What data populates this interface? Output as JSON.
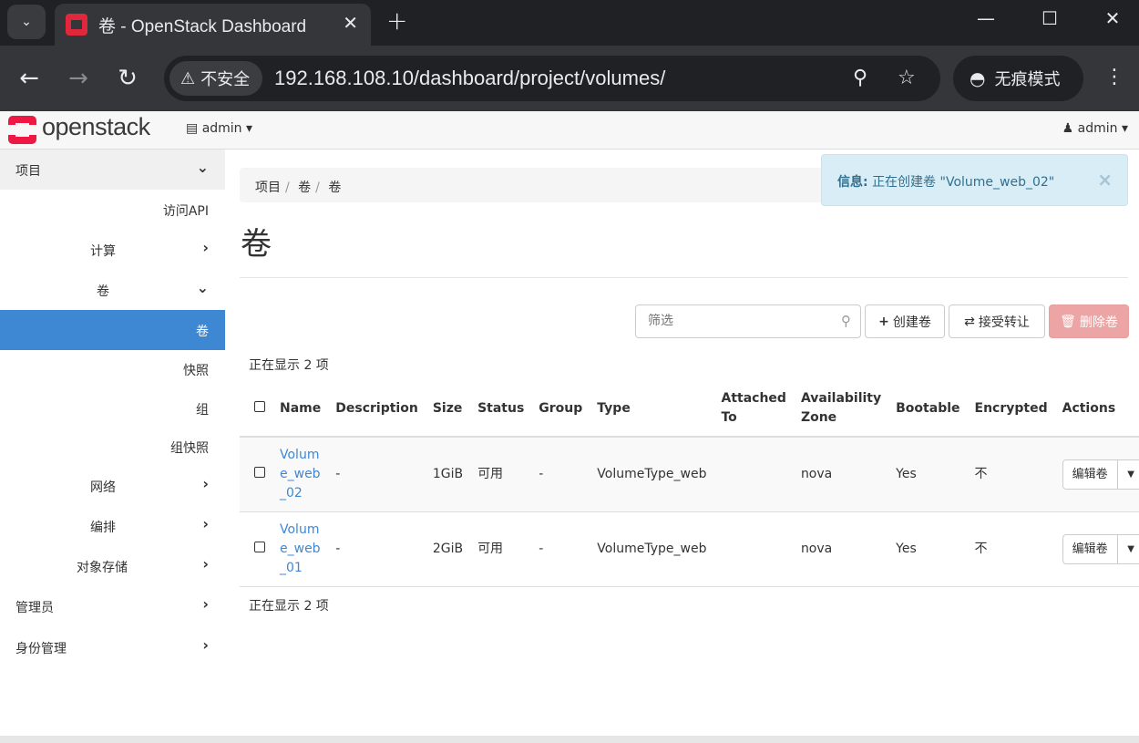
{
  "browser": {
    "tab_title": "卷 - OpenStack Dashboard",
    "security_label": "不安全",
    "url": "192.168.108.10/dashboard/project/volumes/",
    "incognito_label": "无痕模式"
  },
  "header": {
    "logo_text": "openstack",
    "project_label": "admin",
    "user_label": "admin"
  },
  "sidebar": {
    "items": [
      {
        "label": "项目"
      },
      {
        "label": "访问API"
      },
      {
        "label": "计算"
      },
      {
        "label": "卷"
      },
      {
        "label": "卷"
      },
      {
        "label": "快照"
      },
      {
        "label": "组"
      },
      {
        "label": "组快照"
      },
      {
        "label": "网络"
      },
      {
        "label": "编排"
      },
      {
        "label": "对象存储"
      },
      {
        "label": "管理员"
      },
      {
        "label": "身份管理"
      }
    ]
  },
  "breadcrumb": [
    "项目",
    "卷",
    "卷"
  ],
  "alert": {
    "label": "信息:",
    "message": "正在创建卷 \"Volume_web_02\""
  },
  "page_title": "卷",
  "toolbar": {
    "filter_placeholder": "筛选",
    "create_label": "创建卷",
    "accept_transfer_label": "接受转让",
    "delete_label": "删除卷"
  },
  "count_text": "正在显示 2 项",
  "table": {
    "headers": {
      "name": "Name",
      "description": "Description",
      "size": "Size",
      "status": "Status",
      "group": "Group",
      "type": "Type",
      "attached_to": "Attached To",
      "availability_zone": "Availability Zone",
      "bootable": "Bootable",
      "encrypted": "Encrypted",
      "actions": "Actions"
    },
    "rows": [
      {
        "name": "Volume_web_02",
        "description": "-",
        "size": "1GiB",
        "status": "可用",
        "group": "-",
        "type": "VolumeType_web",
        "attached_to": "",
        "availability_zone": "nova",
        "bootable": "Yes",
        "encrypted": "不",
        "action_label": "编辑卷"
      },
      {
        "name": "Volume_web_01",
        "description": "-",
        "size": "2GiB",
        "status": "可用",
        "group": "-",
        "type": "VolumeType_web",
        "attached_to": "",
        "availability_zone": "nova",
        "bootable": "Yes",
        "encrypted": "不",
        "action_label": "编辑卷"
      }
    ]
  }
}
